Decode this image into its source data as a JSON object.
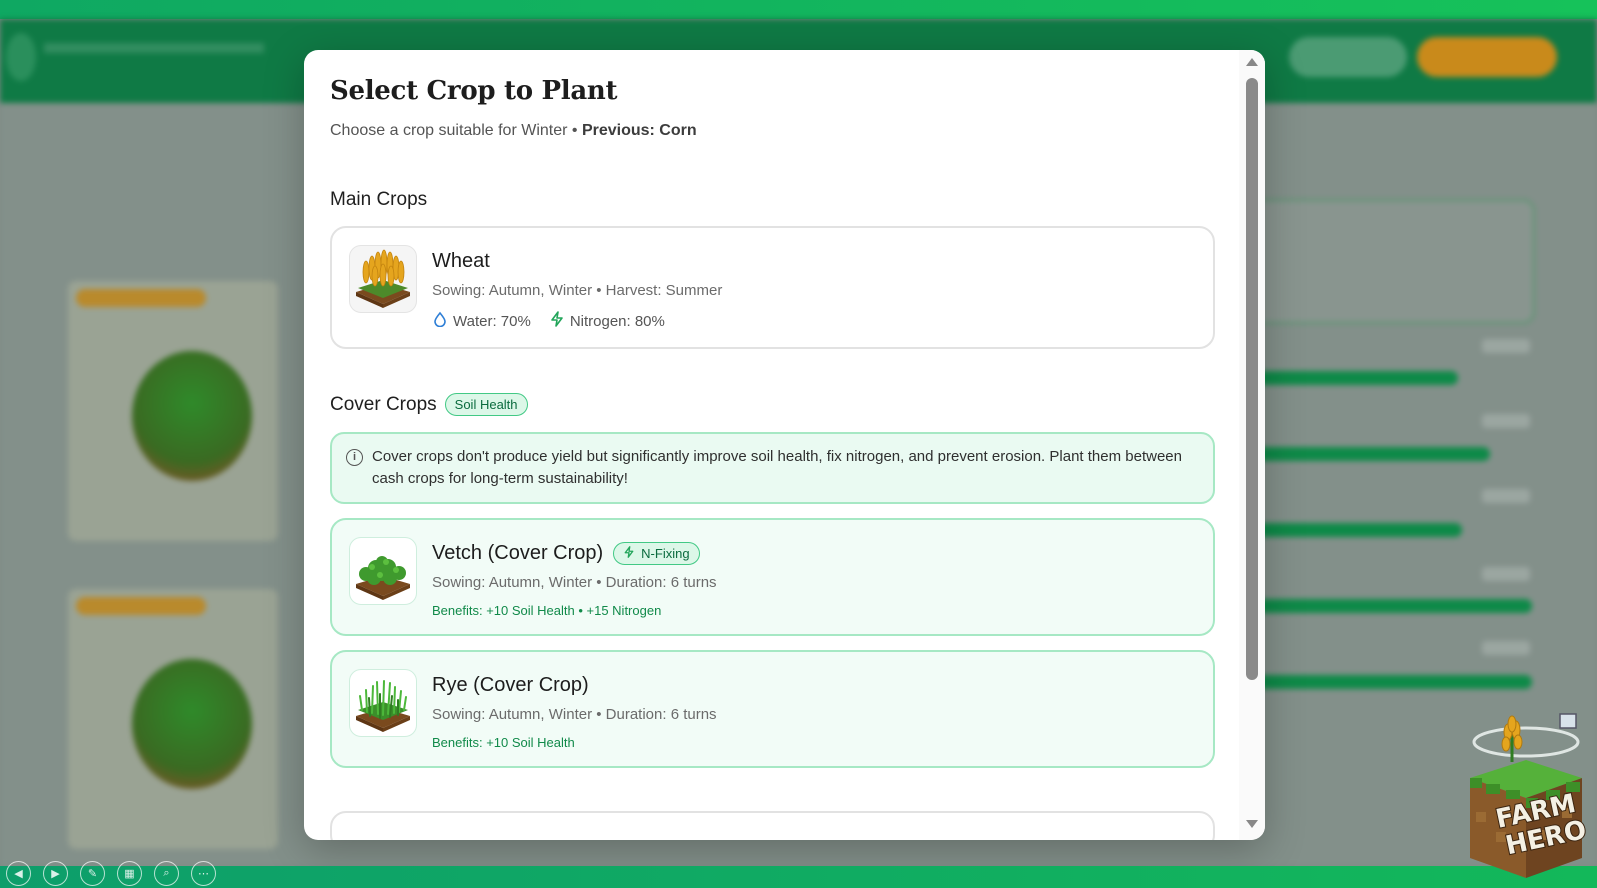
{
  "modal": {
    "title": "Select Crop to Plant",
    "subtitle_prefix": "Choose a crop suitable for Winter • ",
    "subtitle_previous": "Previous: Corn"
  },
  "sections": {
    "main_title": "Main Crops",
    "cover_title": "Cover Crops",
    "cover_badge": "Soil Health",
    "cover_info": "Cover crops don't produce yield but significantly improve soil health, fix nitrogen, and prevent erosion. Plant them between cash crops for long-term sustainability!"
  },
  "crops": {
    "wheat": {
      "name": "Wheat",
      "detail": "Sowing: Autumn, Winter • Harvest: Summer",
      "water": "Water: 70%",
      "nitrogen": "Nitrogen: 80%"
    },
    "vetch": {
      "name": "Vetch (Cover Crop)",
      "badge": "N-Fixing",
      "detail": "Sowing: Autumn, Winter • Duration: 6 turns",
      "benefits": "Benefits: +10 Soil Health • +15 Nitrogen"
    },
    "rye": {
      "name": "Rye (Cover Crop)",
      "detail": "Sowing: Autumn, Winter • Duration: 6 turns",
      "benefits": "Benefits: +10 Soil Health"
    }
  },
  "logo": {
    "line1": "FARM",
    "line2": "HERO"
  },
  "colors": {
    "accent_green": "#16c25a",
    "cover_border": "#a6e8c4",
    "benefit_text": "#118a4a",
    "water_icon": "#2f7fd6",
    "nitrogen_icon": "#22a55a"
  },
  "icons": {
    "water": "water-drop-icon",
    "nitrogen": "lightning-icon",
    "info": "info-circle-icon"
  }
}
